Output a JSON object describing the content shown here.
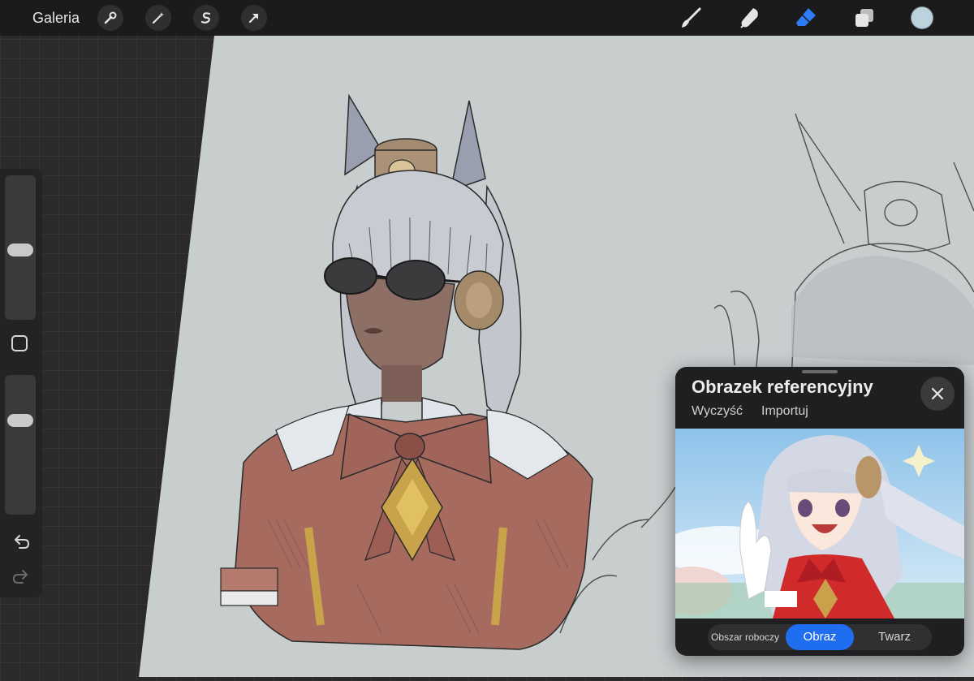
{
  "toolbar": {
    "gallery_label": "Galeria",
    "left_tools": [
      "wrench-icon",
      "magic-wand-icon",
      "selection-icon",
      "transform-arrow-icon"
    ],
    "right_tools": [
      "brush-icon",
      "smudge-icon",
      "eraser-icon",
      "layers-icon"
    ],
    "active_tool": "eraser",
    "current_color": "#bcd3dd",
    "accent_color": "#2f7cf6"
  },
  "sidebar": {
    "brush_size_level": 0.48,
    "opacity_level": 0.7,
    "icons": [
      "modify-square-icon",
      "undo-icon",
      "redo-icon"
    ]
  },
  "reference_panel": {
    "title": "Obrazek referencyjny",
    "clear_label": "Wyczyść",
    "import_label": "Importuj",
    "segments": [
      "Obszar roboczy",
      "Obraz",
      "Twarz"
    ],
    "active_segment": "Obraz"
  }
}
